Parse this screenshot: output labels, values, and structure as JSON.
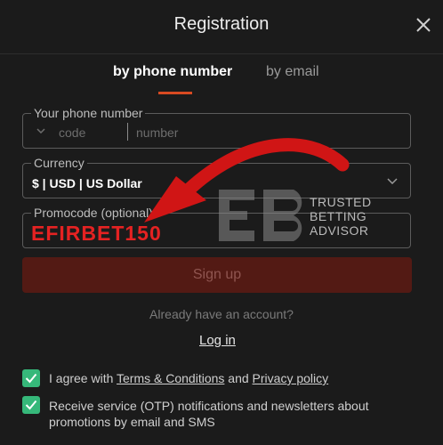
{
  "dialog": {
    "title": "Registration"
  },
  "tabs": {
    "phone": "by phone number",
    "email": "by email"
  },
  "phone_field": {
    "label": "Your phone number",
    "code_placeholder": "code",
    "number_placeholder": "number"
  },
  "currency_field": {
    "label": "Currency",
    "value": "$ | USD | US Dollar"
  },
  "promo_field": {
    "label": "Promocode (optional)",
    "value": "EFIRBET150"
  },
  "buttons": {
    "signup": "Sign up",
    "login": "Log in"
  },
  "already_text": "Already have an account?",
  "consents": {
    "agree_prefix": "I agree with",
    "terms": "Terms & Conditions",
    "and": "and",
    "privacy": "Privacy policy",
    "otp": "Receive service (OTP) notifications and newsletters about promotions by email and SMS"
  },
  "watermark": {
    "line1": "TRUSTED",
    "line2": "BETTING",
    "line3": "ADVISOR"
  },
  "colors": {
    "accent": "#d84a22",
    "checkbox": "#36b87a",
    "promo_text": "#e52222",
    "signup_bg": "#531a14"
  }
}
